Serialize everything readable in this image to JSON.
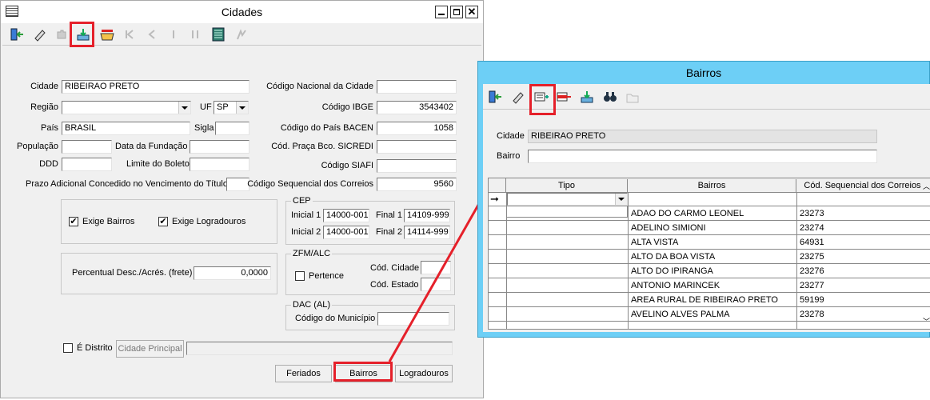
{
  "cidades": {
    "title": "Cidades",
    "fields": {
      "cidade_label": "Cidade",
      "cidade_value": "RIBEIRAO PRETO",
      "regiao_label": "Região",
      "regiao_value": "",
      "uf_label": "UF",
      "uf_value": "SP",
      "pais_label": "País",
      "pais_value": "BRASIL",
      "sigla_label": "Sigla",
      "populacao_label": "População",
      "data_fundacao_label": "Data da Fundação",
      "ddd_label": "DDD",
      "limite_boleto_label": "Limite do Boleto",
      "prazo_label": "Prazo Adicional Concedido no Vencimento do Título",
      "cod_nacional_label": "Código Nacional da Cidade",
      "cod_ibge_label": "Código IBGE",
      "cod_ibge_value": "3543402",
      "cod_pais_bacen_label": "Código do País BACEN",
      "cod_pais_bacen_value": "1058",
      "cod_praca_label": "Cód. Praça Bco. SICREDI",
      "cod_siafi_label": "Código SIAFI",
      "cod_seq_correios_label": "Código Sequencial dos Correios",
      "cod_seq_correios_value": "9560"
    },
    "cep": {
      "title": "CEP",
      "inicial1_label": "Inicial 1",
      "inicial1_value": "14000-001",
      "final1_label": "Final 1",
      "final1_value": "14109-999",
      "inicial2_label": "Inicial 2",
      "inicial2_value": "14000-001",
      "final2_label": "Final 2",
      "final2_value": "14114-999"
    },
    "checks": {
      "exige_bairros": "Exige Bairros",
      "exige_logradouros": "Exige Logradouros",
      "check_mark": "✔"
    },
    "frete": {
      "label": "Percentual Desc./Acrés. (frete)",
      "value": "0,0000"
    },
    "zfm": {
      "title": "ZFM/ALC",
      "pertence": "Pertence",
      "cod_cidade": "Cód. Cidade",
      "cod_estado": "Cód. Estado"
    },
    "dac": {
      "title": "DAC (AL)",
      "cod_municipio": "Código do Município"
    },
    "distrito": {
      "label": "É Distrito",
      "cidade_principal": "Cidade Principal"
    },
    "buttons": {
      "feriados": "Feriados",
      "bairros": "Bairros",
      "logradouros": "Logradouros"
    }
  },
  "bairros": {
    "title": "Bairros",
    "cidade_label": "Cidade",
    "cidade_value": "RIBEIRAO PRETO",
    "bairro_label": "Bairro",
    "grid": {
      "columns": [
        "Tipo",
        "Bairros",
        "Cód. Sequencial dos Correios"
      ],
      "rows": [
        {
          "nome": "ADAO DO CARMO LEONEL",
          "cod": "23273"
        },
        {
          "nome": "ADELINO SIMIONI",
          "cod": "23274"
        },
        {
          "nome": "ALTA VISTA",
          "cod": "64931"
        },
        {
          "nome": "ALTO DA BOA VISTA",
          "cod": "23275"
        },
        {
          "nome": "ALTO DO IPIRANGA",
          "cod": "23276"
        },
        {
          "nome": "ANTONIO MARINCEK",
          "cod": "23277"
        },
        {
          "nome": "AREA RURAL DE RIBEIRAO PRETO",
          "cod": "59199"
        },
        {
          "nome": "AVELINO ALVES PALMA",
          "cod": "23278"
        }
      ]
    }
  },
  "colors": {
    "highlight": "#e5202a",
    "bairros_titlebar": "#6dcff6"
  }
}
